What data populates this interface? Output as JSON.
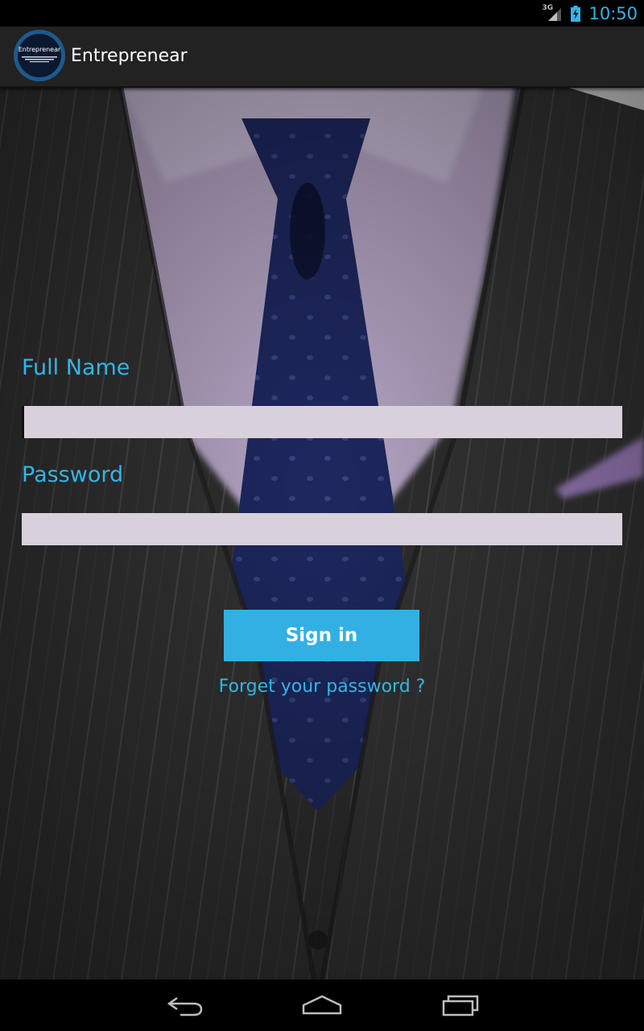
{
  "status_bar": {
    "network_type": "3G",
    "time": "10:50",
    "icons": [
      "signal-icon",
      "battery-charging-icon"
    ]
  },
  "action_bar": {
    "app_title": "Entreprenear",
    "logo_text": "Entreprenear"
  },
  "form": {
    "full_name_label": "Full Name",
    "full_name_value": "",
    "password_label": "Password",
    "password_value": "",
    "sign_in_label": "Sign in",
    "forgot_password_label": "Forget your password ?"
  },
  "nav_bar": {
    "icons": [
      "back-icon",
      "home-icon",
      "recent-apps-icon"
    ]
  },
  "colors": {
    "accent": "#33b5e5",
    "button": "#33b0e3",
    "input_bg": "#d8d1db",
    "action_bar_bg": "#222222"
  }
}
